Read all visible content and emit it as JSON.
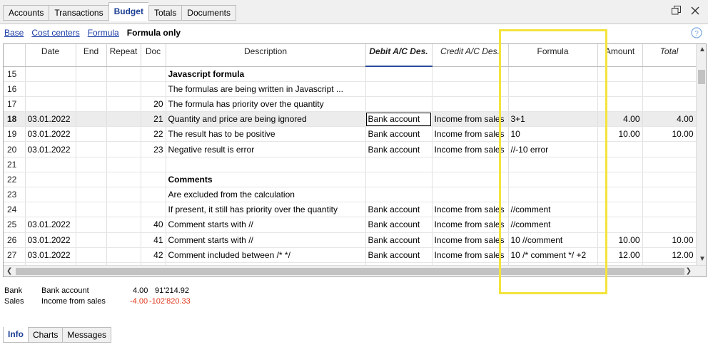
{
  "tabs": [
    {
      "label": "Accounts"
    },
    {
      "label": "Transactions"
    },
    {
      "label": "Budget"
    },
    {
      "label": "Totals"
    },
    {
      "label": "Documents"
    }
  ],
  "views": [
    {
      "label": "Base"
    },
    {
      "label": "Cost centers"
    },
    {
      "label": "Formula"
    },
    {
      "label": "Formula only"
    }
  ],
  "grid": {
    "columns": [
      "",
      "Date",
      "End",
      "Repeat",
      "Doc",
      "Description",
      "Debit A/C Des.",
      "Credit A/C Des.",
      "Formula",
      "Amount",
      "Total"
    ],
    "rows": [
      {
        "n": "15",
        "date": "",
        "doc": "",
        "desc": "Javascript formula",
        "debit": "",
        "credit": "",
        "formula": "",
        "amount": "",
        "total": ""
      },
      {
        "n": "16",
        "date": "",
        "doc": "",
        "desc": "The formulas are being written in Javascript ...",
        "debit": "",
        "credit": "",
        "formula": "",
        "amount": "",
        "total": ""
      },
      {
        "n": "17",
        "date": "",
        "doc": "20",
        "desc": "The formula has priority over the quantity",
        "debit": "",
        "credit": "",
        "formula": "",
        "amount": "",
        "total": ""
      },
      {
        "n": "18",
        "date": "03.01.2022",
        "doc": "21",
        "desc": "Quantity and price are being ignored",
        "debit": "Bank account",
        "credit": "Income from sales",
        "formula": "3+1",
        "amount": "4.00",
        "total": "4.00"
      },
      {
        "n": "19",
        "date": "03.01.2022",
        "doc": "22",
        "desc": "The result has to be positive",
        "debit": "Bank account",
        "credit": "Income from sales",
        "formula": "10",
        "amount": "10.00",
        "total": "10.00"
      },
      {
        "n": "20",
        "date": "03.01.2022",
        "doc": "23",
        "desc": "Negative result is error",
        "debit": "Bank account",
        "credit": "Income from sales",
        "formula": "//-10 error",
        "amount": "",
        "total": ""
      },
      {
        "n": "21",
        "date": "",
        "doc": "",
        "desc": "",
        "debit": "",
        "credit": "",
        "formula": "",
        "amount": "",
        "total": ""
      },
      {
        "n": "22",
        "date": "",
        "doc": "",
        "desc": "Comments",
        "debit": "",
        "credit": "",
        "formula": "",
        "amount": "",
        "total": ""
      },
      {
        "n": "23",
        "date": "",
        "doc": "",
        "desc": "Are excluded from the calculation",
        "debit": "",
        "credit": "",
        "formula": "",
        "amount": "",
        "total": ""
      },
      {
        "n": "24",
        "date": "",
        "doc": "",
        "desc": "If present, it still has priority over the quantity",
        "debit": "Bank account",
        "credit": "Income from sales",
        "formula": "//comment",
        "amount": "",
        "total": ""
      },
      {
        "n": "25",
        "date": "03.01.2022",
        "doc": "40",
        "desc": "Comment starts with //",
        "debit": "Bank account",
        "credit": "Income from sales",
        "formula": "//comment",
        "amount": "",
        "total": ""
      },
      {
        "n": "26",
        "date": "03.01.2022",
        "doc": "41",
        "desc": "Comment starts with //",
        "debit": "Bank account",
        "credit": "Income from sales",
        "formula": "10 //comment",
        "amount": "10.00",
        "total": "10.00"
      },
      {
        "n": "27",
        "date": "03.01.2022",
        "doc": "42",
        "desc": "Comment included between /* */",
        "debit": "Bank account",
        "credit": "Income from sales",
        "formula": "10 /* comment */ +2",
        "amount": "12.00",
        "total": "12.00"
      },
      {
        "n": "",
        "date": "",
        "doc": "",
        "desc": "",
        "debit": "",
        "credit": "",
        "formula": "",
        "amount": "",
        "total": ""
      }
    ]
  },
  "info": {
    "rows": [
      {
        "code": "Bank",
        "name": "Bank account",
        "amount": "4.00",
        "balance": "91'214.92"
      },
      {
        "code": "Sales",
        "name": "Income from sales",
        "amount": "-4.00",
        "balance": "-102'820.33"
      }
    ]
  },
  "bottom_tabs": [
    {
      "label": "Info"
    },
    {
      "label": "Charts"
    },
    {
      "label": "Messages"
    }
  ],
  "icons": {
    "restore": "restore-window-icon",
    "close": "close-icon",
    "help": "help-icon"
  },
  "colors": {
    "accent": "#1b3f94",
    "link": "#1c3fa8",
    "negative": "#e03a1f",
    "highlight_frame": "#f3e43c",
    "selected_row": "#ececec"
  }
}
